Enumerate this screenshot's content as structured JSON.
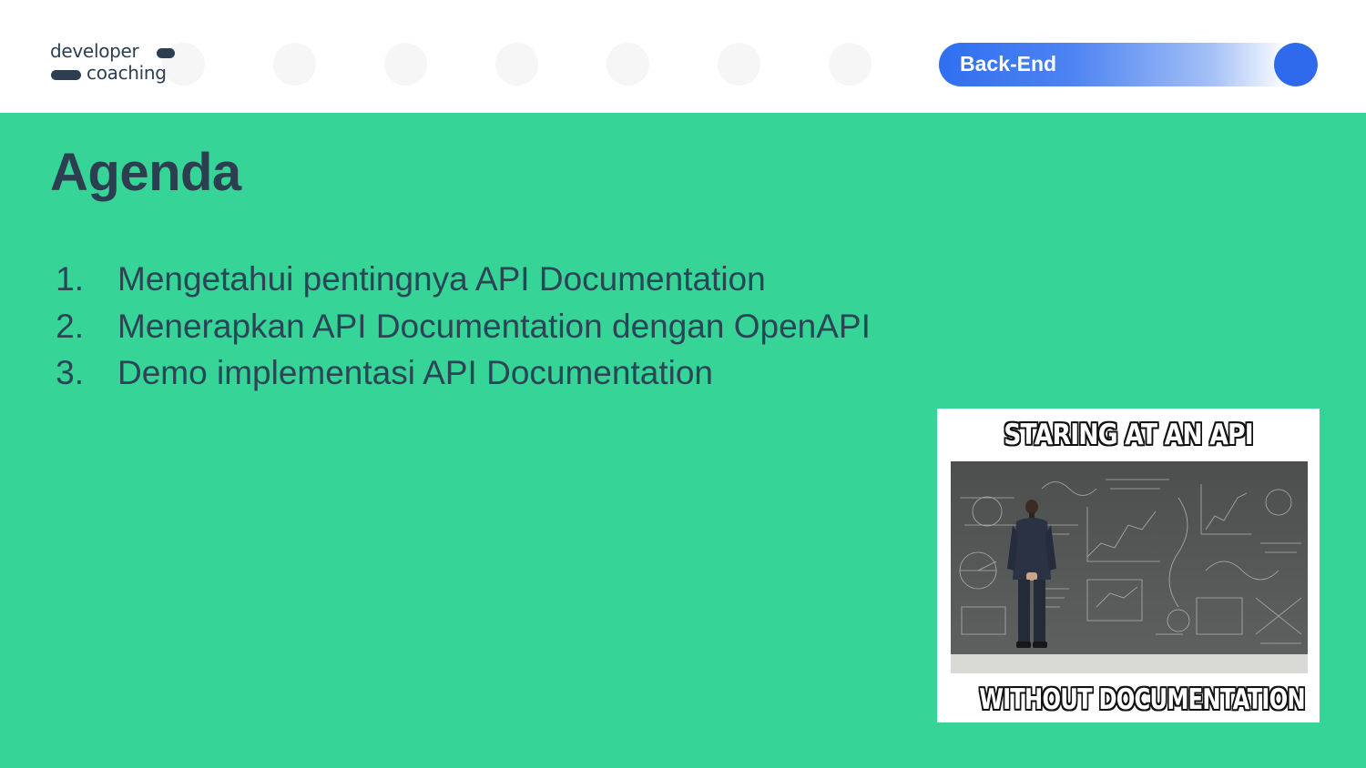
{
  "header": {
    "logo": {
      "line1": "developer",
      "line2": "coaching"
    },
    "badge_label": "Back-End",
    "colors": {
      "badge_blue": "#2f69ec",
      "background_green": "#36d497",
      "text_dark": "#2c3e50"
    }
  },
  "slide": {
    "title": "Agenda",
    "items": [
      {
        "num": "1.",
        "text": "Mengetahui pentingnya API Documentation"
      },
      {
        "num": "2.",
        "text": "Menerapkan API Documentation dengan OpenAPI"
      },
      {
        "num": "3.",
        "text": "Demo implementasi API Documentation"
      }
    ]
  },
  "meme": {
    "top_caption": "STARING AT AN API",
    "bottom_caption": "WITHOUT DOCUMENTATION"
  }
}
